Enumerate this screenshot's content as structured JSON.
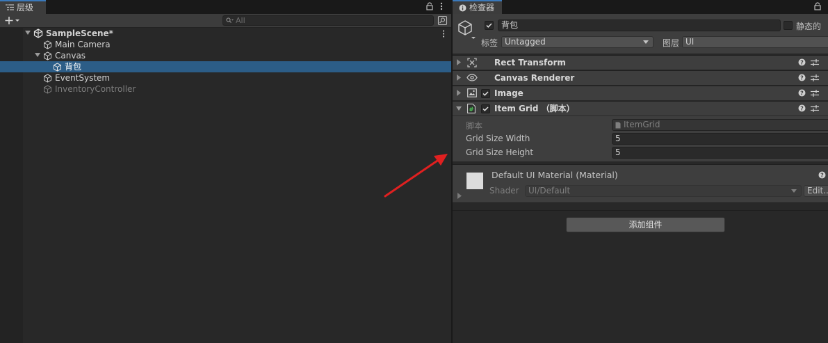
{
  "hierarchy": {
    "tab_label": "层级",
    "search_placeholder": "All",
    "items": [
      {
        "label": "SampleScene*",
        "icon": "unity-scene-icon",
        "bold": true
      },
      {
        "label": "Main Camera",
        "icon": "gameobject-cube-icon"
      },
      {
        "label": "Canvas",
        "icon": "gameobject-cube-icon"
      },
      {
        "label": "背包",
        "icon": "gameobject-cube-icon",
        "selected": true
      },
      {
        "label": "EventSystem",
        "icon": "gameobject-cube-icon"
      },
      {
        "label": "InventoryController",
        "icon": "gameobject-cube-icon",
        "inactive": true
      }
    ]
  },
  "inspector": {
    "tab_label": "检查器",
    "object_name": "背包",
    "static_label": "静态的",
    "tag_label": "标签",
    "tag_value": "Untagged",
    "layer_label": "图层",
    "layer_value": "UI",
    "components": [
      {
        "name": "Rect Transform",
        "icon": "rect-transform-icon"
      },
      {
        "name": "Canvas Renderer",
        "icon": "eye-icon"
      },
      {
        "name": "Image",
        "icon": "image-icon"
      },
      {
        "name": "Item Grid （脚本）",
        "icon": "csharp-script-icon"
      }
    ],
    "script": {
      "script_label": "脚本",
      "script_value": "ItemGrid",
      "fields": [
        {
          "label": "Grid Size Width",
          "value": "5"
        },
        {
          "label": "Grid Size Height",
          "value": "5"
        }
      ]
    },
    "material": {
      "title": "Default UI Material (Material)",
      "shader_label": "Shader",
      "shader_value": "UI/Default",
      "edit_label": "Edit..."
    },
    "add_component_label": "添加组件"
  },
  "colors": {
    "selection": "#2c5d87",
    "tab_accent": "#3a79bb",
    "annotation_arrow": "#e02020"
  }
}
